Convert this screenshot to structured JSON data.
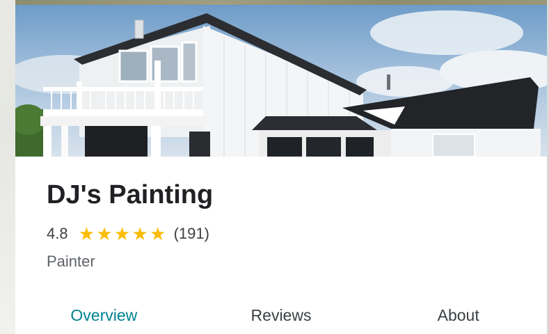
{
  "place": {
    "name": "DJ's Painting",
    "rating": "4.8",
    "stars": [
      "★",
      "★",
      "★",
      "★",
      "★"
    ],
    "review_count": "(191)",
    "category": "Painter",
    "photo": "house-photo"
  },
  "tabs": [
    {
      "label": "Overview",
      "active": true
    },
    {
      "label": "Reviews",
      "active": false
    },
    {
      "label": "About",
      "active": false
    }
  ],
  "colors": {
    "star": "#fbbc04",
    "active_tab": "#00838f",
    "title": "#202124"
  }
}
